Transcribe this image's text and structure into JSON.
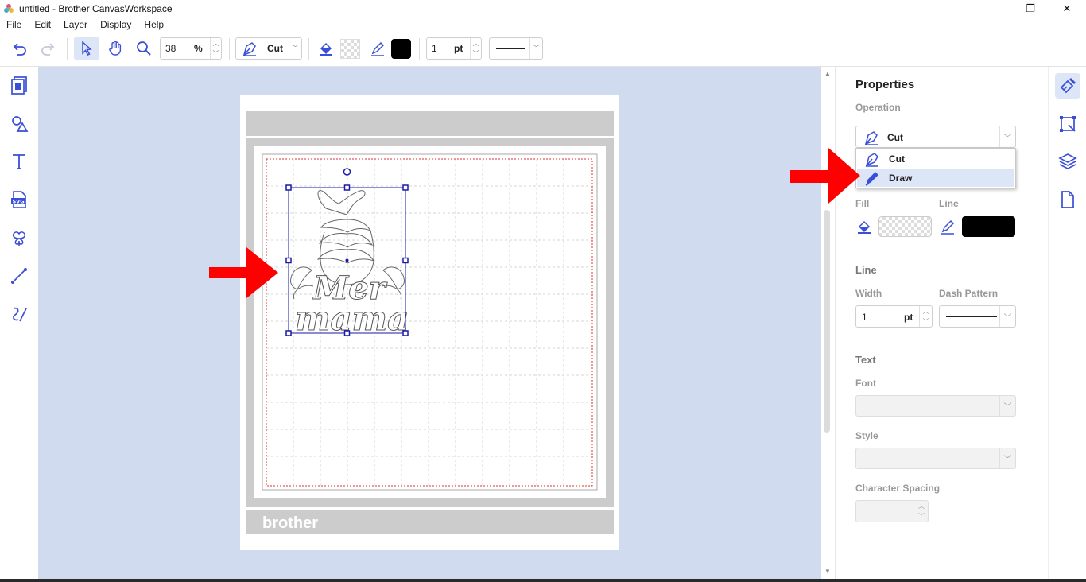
{
  "window": {
    "title": "untitled - Brother CanvasWorkspace",
    "minimize": "—",
    "maximize": "❐",
    "close": "✕"
  },
  "menu": [
    "File",
    "Edit",
    "Layer",
    "Display",
    "Help"
  ],
  "toolbar": {
    "zoom_value": "38",
    "zoom_unit": "%",
    "operation_label": "Cut",
    "line_width_value": "1",
    "line_width_unit": "pt",
    "line_color": "#000000"
  },
  "canvas": {
    "mat_brand": "brother",
    "design_text_line1": "Mer",
    "design_text_line2": "mama"
  },
  "properties": {
    "title": "Properties",
    "operation_label": "Operation",
    "operation_value": "Cut",
    "operation_options": [
      "Cut",
      "Draw"
    ],
    "operation_highlighted": "Draw",
    "fill_label": "Fill",
    "line_label": "Line",
    "line_section": "Line",
    "width_label": "Width",
    "width_value": "1",
    "width_unit": "pt",
    "dash_label": "Dash Pattern",
    "text_section": "Text",
    "font_label": "Font",
    "style_label": "Style",
    "char_spacing_label": "Character Spacing"
  },
  "colors": {
    "accent": "#3a4fd8",
    "canvas_bg": "#d1dbef",
    "annotation_arrow": "#ff0000",
    "selection": "#1a1aa8"
  }
}
